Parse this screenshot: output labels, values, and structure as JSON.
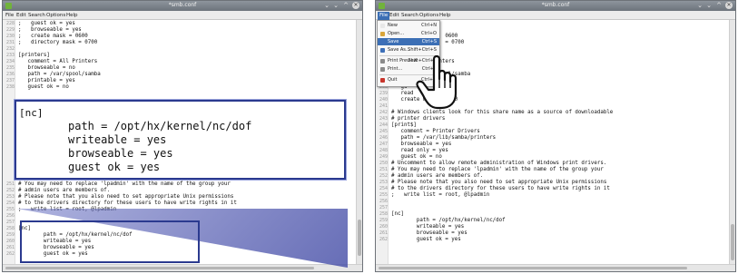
{
  "window": {
    "title": "*smb.conf",
    "controls": {
      "more": "⌄",
      "minimize": "⌄",
      "maximize": "^",
      "close": "✕"
    }
  },
  "menu": [
    "File",
    "Edit",
    "Search",
    "Options",
    "Help"
  ],
  "left_editor": {
    "top_lines": [
      {
        "n": "228",
        "t": ";   guest ok = yes"
      },
      {
        "n": "229",
        "t": ";   browseable = yes"
      },
      {
        "n": "230",
        "t": ";   create mask = 0600"
      },
      {
        "n": "231",
        "t": ";   directory mask = 0700"
      },
      {
        "n": "232",
        "t": ""
      },
      {
        "n": "233",
        "t": "[printers]"
      },
      {
        "n": "234",
        "t": "   comment = All Printers"
      },
      {
        "n": "235",
        "t": "   browseable = no"
      },
      {
        "n": "236",
        "t": "   path = /var/spool/samba"
      },
      {
        "n": "237",
        "t": "   printable = yes"
      },
      {
        "n": "238",
        "t": "   guest ok = no"
      }
    ],
    "bottom_lines": [
      {
        "n": "251",
        "t": "# You may need to replace 'lpadmin' with the name of the group your"
      },
      {
        "n": "252",
        "t": "# admin users are members of."
      },
      {
        "n": "253",
        "t": "# Please note that you also need to set appropriate Unix permissions"
      },
      {
        "n": "254",
        "t": "# to the drivers directory for these users to have write rights in it"
      },
      {
        "n": "255",
        "t": ";   write list = root, @lpadmin"
      },
      {
        "n": "256",
        "t": ""
      },
      {
        "n": "257",
        "t": ""
      },
      {
        "n": "258",
        "t": "[nc]"
      },
      {
        "n": "259",
        "t": "        path = /opt/hx/kernel/nc/dof"
      },
      {
        "n": "260",
        "t": "        writeable = yes"
      },
      {
        "n": "261",
        "t": "        browseable = yes"
      },
      {
        "n": "262",
        "t": "        guest ok = yes"
      }
    ]
  },
  "zoom": {
    "header": "[nc]",
    "lines": [
      "path = /opt/hx/kernel/nc/dof",
      "writeable = yes",
      "browseable = yes",
      "guest ok = yes"
    ]
  },
  "right_editor": {
    "lines": [
      {
        "n": "228",
        "t": ""
      },
      {
        "n": "229",
        "t": ""
      },
      {
        "n": "230",
        "t": "                 0600"
      },
      {
        "n": "231",
        "t": "                 = 0700"
      },
      {
        "n": "232",
        "t": ""
      },
      {
        "n": "233",
        "t": ""
      },
      {
        "n": "234",
        "t": "              inters"
      },
      {
        "n": "235",
        "t": ""
      },
      {
        "n": "236",
        "t": "                 ol/samba"
      },
      {
        "n": "237",
        "t": "   pr         es"
      },
      {
        "n": "238",
        "t": "   gu          o"
      },
      {
        "n": "239",
        "t": "   read      yes"
      },
      {
        "n": "240",
        "t": "   create mask = 0700"
      },
      {
        "n": "241",
        "t": ""
      },
      {
        "n": "242",
        "t": "# Windows clients look for this share name as a source of downloadable"
      },
      {
        "n": "243",
        "t": "# printer drivers"
      },
      {
        "n": "244",
        "t": "[print$]"
      },
      {
        "n": "245",
        "t": "   comment = Printer Drivers"
      },
      {
        "n": "246",
        "t": "   path = /var/lib/samba/printers"
      },
      {
        "n": "247",
        "t": "   browseable = yes"
      },
      {
        "n": "248",
        "t": "   read only = yes"
      },
      {
        "n": "249",
        "t": "   guest ok = no"
      },
      {
        "n": "250",
        "t": "# Uncomment to allow remote administration of Windows print drivers."
      },
      {
        "n": "251",
        "t": "# You may need to replace 'lpadmin' with the name of the group your"
      },
      {
        "n": "252",
        "t": "# admin users are members of."
      },
      {
        "n": "253",
        "t": "# Please note that you also need to set appropriate Unix permissions"
      },
      {
        "n": "254",
        "t": "# to the drivers directory for these users to have write rights in it"
      },
      {
        "n": "255",
        "t": ";   write list = root, @lpadmin"
      },
      {
        "n": "256",
        "t": ""
      },
      {
        "n": "257",
        "t": ""
      },
      {
        "n": "258",
        "t": "[nc]"
      },
      {
        "n": "259",
        "t": "        path = /opt/hx/kernel/nc/dof"
      },
      {
        "n": "260",
        "t": "        writeable = yes"
      },
      {
        "n": "261",
        "t": "        browseable = yes"
      },
      {
        "n": "262",
        "t": "        guest ok = yes"
      }
    ]
  },
  "file_menu": [
    {
      "label": "New",
      "shortcut": "Ctrl+N",
      "icon": "new-file-icon",
      "color": "#e8e8e8"
    },
    {
      "label": "Open...",
      "shortcut": "Ctrl+O",
      "icon": "open-folder-icon",
      "color": "#d9a53a"
    },
    {
      "label": "Save",
      "shortcut": "Ctrl+S",
      "icon": "save-icon",
      "color": "#3d6fb8",
      "selected": true
    },
    {
      "label": "Save As...",
      "shortcut": "Shift+Ctrl+S",
      "icon": "save-as-icon",
      "color": "#3d6fb8"
    },
    {
      "label": "Print Preview",
      "shortcut": "Shift+Ctrl+P",
      "icon": "print-preview-icon",
      "color": "#8a8a8a"
    },
    {
      "label": "Print...",
      "shortcut": "Ctrl+P",
      "icon": "print-icon",
      "color": "#8a8a8a"
    },
    {
      "label": "Quit",
      "shortcut": "Ctrl+Q",
      "icon": "quit-icon",
      "color": "#c8352b"
    }
  ],
  "scroll": {
    "vertical_position": 0.82,
    "horizontal_position": 0.0
  },
  "colors": {
    "accent": "#3c6fb5",
    "highlight_frame": "#2b3a8f",
    "titlebar": "#7a8189"
  }
}
